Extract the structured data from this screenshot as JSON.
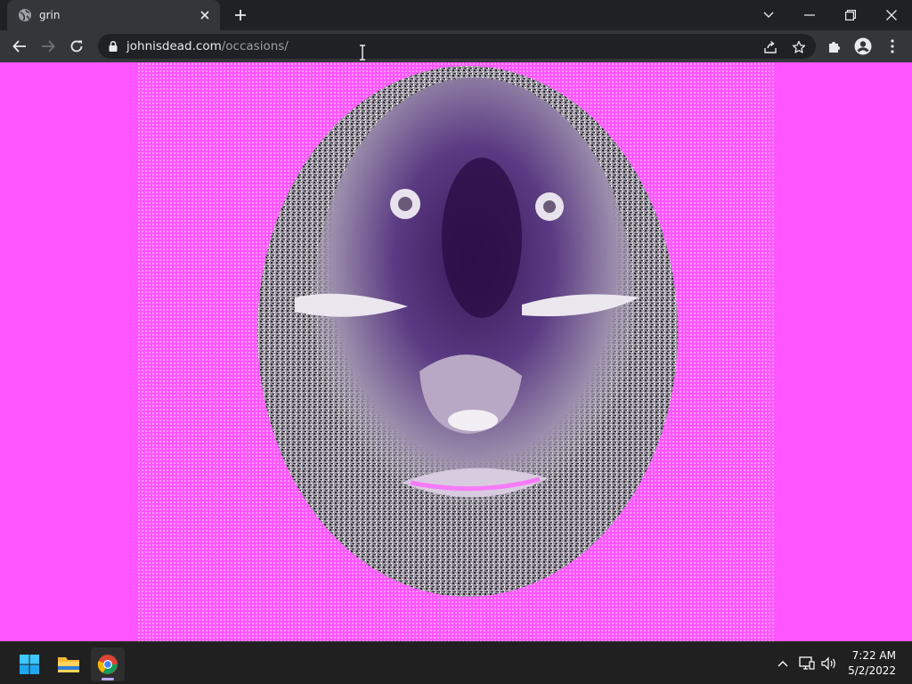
{
  "tab": {
    "title": "grin",
    "favicon": "globe-icon"
  },
  "address_bar": {
    "domain": "johnisdead.com",
    "path": "/occasions/"
  },
  "page": {
    "background_color": "#ff55ff",
    "image": "distorted-face-image"
  },
  "taskbar": {
    "apps": [
      "start-button",
      "file-explorer",
      "chrome"
    ],
    "time": "7:22 AM",
    "date": "5/2/2022"
  },
  "colors": {
    "tab_active": "#35363a",
    "titlebar": "#202124",
    "omnibox": "#202124",
    "taskbar": "#202020"
  }
}
